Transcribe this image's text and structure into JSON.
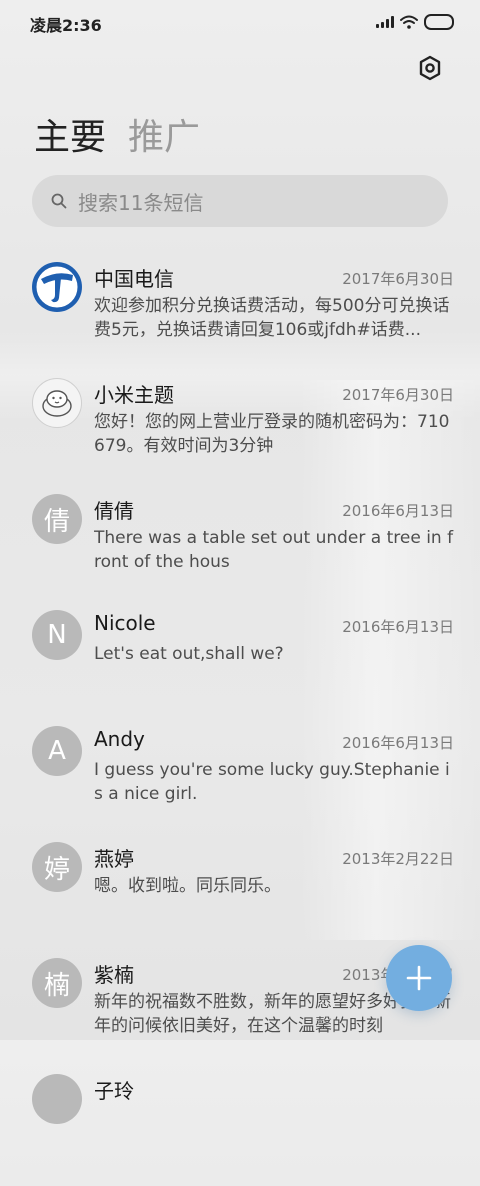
{
  "status_bar": {
    "time": "凌晨2:36"
  },
  "header": {
    "tabs": [
      {
        "label": "主要",
        "active": true
      },
      {
        "label": "推广",
        "active": false
      }
    ]
  },
  "search": {
    "placeholder": "搜索11条短信"
  },
  "messages": [
    {
      "name": "中国电信",
      "date": "2017年6月30日",
      "preview": "欢迎参加积分兑换话费活动，每500分可兑换话费5元，兑换话费请回复106或jfdh#话费...",
      "avatar_type": "logo",
      "avatar_icon": "china-telecom-logo"
    },
    {
      "name": "小米主题",
      "date": "2017年6月30日",
      "preview": "您好！您的网上营业厅登录的随机密码为：710679。有效时间为3分钟",
      "avatar_type": "logo",
      "avatar_icon": "mi-theme-logo"
    },
    {
      "name": "倩倩",
      "date": "2016年6月13日",
      "preview": "There was a table set out under a tree in front of the hous",
      "avatar_letter": "倩"
    },
    {
      "name": "Nicole",
      "date": "2016年6月13日",
      "preview": "Let's eat out,shall we?",
      "avatar_letter": "N"
    },
    {
      "name": "Andy",
      "date": "2016年6月13日",
      "preview": "I guess you're some lucky guy.Stephanie is a nice girl.",
      "avatar_letter": "A"
    },
    {
      "name": "燕婷",
      "date": "2013年2月22日",
      "preview": "嗯。收到啦。同乐同乐。",
      "avatar_letter": "婷"
    },
    {
      "name": "紫楠",
      "date": "2013年2月22日",
      "preview": "新年的祝福数不胜数，新年的愿望好多好多，新年的问候依旧美好，在这个温馨的时刻",
      "avatar_letter": "楠"
    },
    {
      "name": "子玲",
      "date": "",
      "preview": "",
      "avatar_letter": ""
    }
  ],
  "colors": {
    "accent": "#73aee0",
    "avatar_bg": "#b9b9b9",
    "telecom_blue": "#1f5fb0"
  },
  "icons": {
    "settings": "gear-icon",
    "search": "search-icon",
    "compose": "plus-icon"
  }
}
